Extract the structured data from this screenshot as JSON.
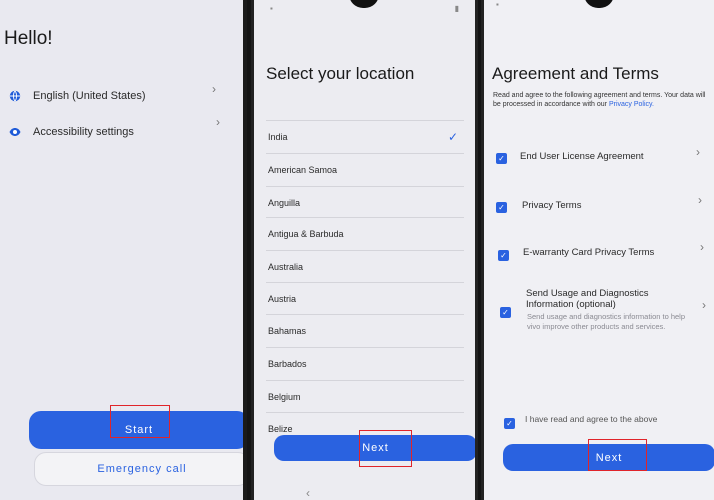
{
  "screen1": {
    "title": "Hello!",
    "rows": [
      {
        "label": "English (United States)",
        "icon": "globe-icon"
      },
      {
        "label": "Accessibility settings",
        "icon": "eye-icon"
      }
    ],
    "start_label": "Start",
    "emergency_label": "Emergency call"
  },
  "screen2": {
    "title": "Select your location",
    "locations": [
      "India",
      "American Samoa",
      "Anguilla",
      "Antigua & Barbuda",
      "Australia",
      "Austria",
      "Bahamas",
      "Barbados",
      "Belgium",
      "Belize"
    ],
    "selected": "India",
    "next_label": "Next"
  },
  "screen3": {
    "title": "Agreement and Terms",
    "subtitle_text": "Read and agree to the following agreement and terms. Your data will be processed in accordance with our",
    "subtitle_link": "Privacy Policy.",
    "terms": [
      {
        "label": "End User License Agreement",
        "checked": true
      },
      {
        "label": "Privacy Terms",
        "checked": true
      },
      {
        "label": "E-warranty Card Privacy Terms",
        "checked": true
      },
      {
        "label": "Send Usage and Diagnostics Information (optional)",
        "checked": true
      }
    ],
    "usage_desc": "Send usage and diagnostics information to help vivo improve other products and services.",
    "agree_all": "I have read and agree to the above",
    "next_label": "Next"
  },
  "colors": {
    "accent": "#2a62e0",
    "highlight_box": "#e0242a"
  }
}
